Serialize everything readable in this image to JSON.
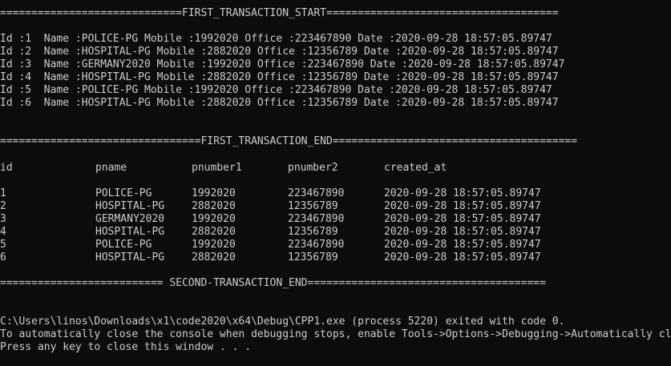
{
  "console": {
    "first_start_separator": "=============================FIRST_TRANSACTION_START=====================================",
    "records": [
      "Id :1  Name :POLICE-PG Mobile :1992020 Office :223467890 Date :2020-09-28 18:57:05.89747",
      "Id :2  Name :HOSPITAL-PG Mobile :2882020 Office :12356789 Date :2020-09-28 18:57:05.89747",
      "Id :3  Name :GERMANY2020 Mobile :1992020 Office :223467890 Date :2020-09-28 18:57:05.89747",
      "Id :4  Name :HOSPITAL-PG Mobile :2882020 Office :12356789 Date :2020-09-28 18:57:05.89747",
      "Id :5  Name :POLICE-PG Mobile :1992020 Office :223467890 Date :2020-09-28 18:57:05.89747",
      "Id :6  Name :HOSPITAL-PG Mobile :2882020 Office :12356789 Date :2020-09-28 18:57:05.89747"
    ],
    "first_end_separator": "================================FIRST_TRANSACTION_END=======================================",
    "table": {
      "headers": [
        "id",
        "pname",
        "pnumber1",
        "pnumber2",
        "created_at"
      ],
      "rows": [
        [
          "1",
          "POLICE-PG",
          "1992020",
          "223467890",
          "2020-09-28 18:57:05.89747"
        ],
        [
          "2",
          "HOSPITAL-PG",
          "2882020",
          "12356789",
          "2020-09-28 18:57:05.89747"
        ],
        [
          "3",
          "GERMANY2020",
          "1992020",
          "223467890",
          "2020-09-28 18:57:05.89747"
        ],
        [
          "4",
          "HOSPITAL-PG",
          "2882020",
          "12356789",
          "2020-09-28 18:57:05.89747"
        ],
        [
          "5",
          "POLICE-PG",
          "1992020",
          "223467890",
          "2020-09-28 18:57:05.89747"
        ],
        [
          "6",
          "HOSPITAL-PG",
          "2882020",
          "12356789",
          "2020-09-28 18:57:05.89747"
        ]
      ]
    },
    "second_end_separator": "========================== SECOND-TRANSACTION_END======================================",
    "exit_message": "C:\\Users\\linos\\Downloads\\x1\\code2020\\x64\\Debug\\CPP1.exe (process 5220) exited with code 0.",
    "auto_close_message": "To automatically close the console when debugging stops, enable Tools->Options->Debugging->Automatically close the console when debugging stops.",
    "press_key_message": "Press any key to close this window . . ."
  },
  "colors": {
    "background": "#0c0c0c",
    "text": "#cccccc"
  }
}
